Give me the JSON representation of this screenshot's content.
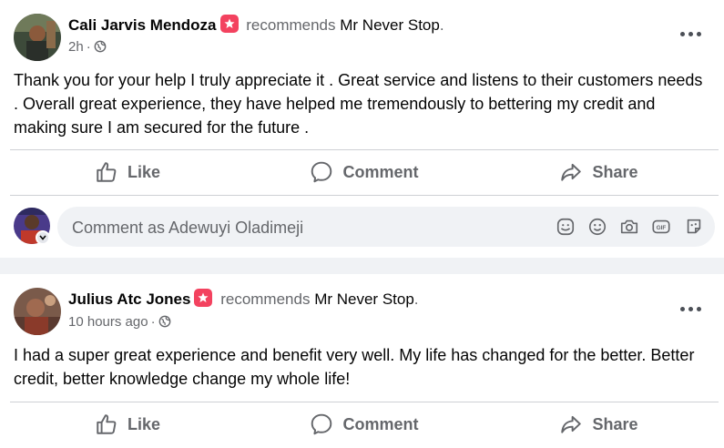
{
  "posts": [
    {
      "author": "Cali Jarvis Mendoza",
      "verb": "recommends",
      "page": "Mr Never Stop",
      "page_suffix": ".",
      "time": "2h",
      "dot": "·",
      "privacy_icon": "globe-icon",
      "text": "Thank you for your help I truly appreciate it . Great service and listens to their customers needs . Overall great experience, they have helped me tremendously to bettering my credit and making sure I am secured for the future .",
      "actions": {
        "like": "Like",
        "comment": "Comment",
        "share": "Share"
      },
      "comment_placeholder": "Comment as Adewuyi Oladimeji"
    },
    {
      "author": "Julius Atc Jones",
      "verb": "recommends",
      "page": "Mr Never Stop",
      "page_suffix": ".",
      "time": "10 hours ago",
      "dot": "·",
      "privacy_icon": "globe-icon",
      "text": "I had a super great experience and benefit very well. My life has changed for the better. Better credit, better knowledge change my whole life!",
      "actions": {
        "like": "Like",
        "comment": "Comment",
        "share": "Share"
      }
    }
  ],
  "colors": {
    "text_primary": "#050505",
    "text_secondary": "#65676b",
    "recommend_badge": "#f3425f",
    "divider": "#ced0d4",
    "input_bg": "#f0f2f5"
  },
  "icons": {
    "comment_tools": [
      "sticker-icon",
      "emoji-icon",
      "camera-icon",
      "gif-icon",
      "avatar-sticker-icon"
    ]
  }
}
